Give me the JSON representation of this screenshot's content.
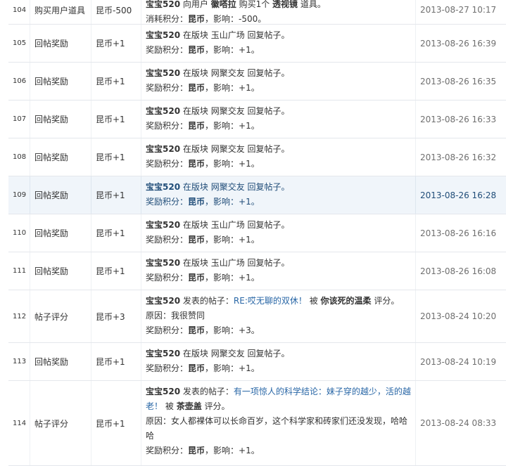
{
  "rows": [
    {
      "id": "104",
      "type": "购买用户道具",
      "amount": "昆币-500",
      "time": "2013-08-27 10:17",
      "line1": [
        "宝宝520",
        "向用户",
        "徽嗒拉",
        "购买1个",
        "透视镜",
        "道具。"
      ],
      "line2": [
        "消耗积分：",
        "昆币",
        "，影响：-500。"
      ]
    },
    {
      "id": "105",
      "type": "回帖奖励",
      "amount": "昆币+1",
      "time": "2013-08-26 16:39",
      "line1": [
        "宝宝520",
        "在版块 玉山广场 回复帖子。"
      ],
      "line2": [
        "奖励积分：",
        "昆币",
        "，影响：+1。"
      ]
    },
    {
      "id": "106",
      "type": "回帖奖励",
      "amount": "昆币+1",
      "time": "2013-08-26 16:35",
      "line1": [
        "宝宝520",
        "在版块 网聚交友 回复帖子。"
      ],
      "line2": [
        "奖励积分：",
        "昆币",
        "，影响：+1。"
      ]
    },
    {
      "id": "107",
      "type": "回帖奖励",
      "amount": "昆币+1",
      "time": "2013-08-26 16:33",
      "line1": [
        "宝宝520",
        "在版块 网聚交友 回复帖子。"
      ],
      "line2": [
        "奖励积分：",
        "昆币",
        "，影响：+1。"
      ]
    },
    {
      "id": "108",
      "type": "回帖奖励",
      "amount": "昆币+1",
      "time": "2013-08-26 16:32",
      "line1": [
        "宝宝520",
        "在版块 网聚交友 回复帖子。"
      ],
      "line2": [
        "奖励积分：",
        "昆币",
        "，影响：+1。"
      ]
    },
    {
      "id": "109",
      "type": "回帖奖励",
      "amount": "昆币+1",
      "time": "2013-08-26 16:28",
      "line1": [
        "宝宝520",
        "在版块 网聚交友 回复帖子。"
      ],
      "line2": [
        "奖励积分：",
        "昆币",
        "，影响：+1。"
      ]
    },
    {
      "id": "110",
      "type": "回帖奖励",
      "amount": "昆币+1",
      "time": "2013-08-26 16:16",
      "line1": [
        "宝宝520",
        "在版块 玉山广场 回复帖子。"
      ],
      "line2": [
        "奖励积分：",
        "昆币",
        "，影响：+1。"
      ]
    },
    {
      "id": "111",
      "type": "回帖奖励",
      "amount": "昆币+1",
      "time": "2013-08-26 16:08",
      "line1": [
        "宝宝520",
        "在版块 玉山广场 回复帖子。"
      ],
      "line2": [
        "奖励积分：",
        "昆币",
        "，影响：+1。"
      ]
    },
    {
      "id": "112",
      "type": "帖子评分",
      "amount": "昆币+3",
      "time": "2013-08-24 10:20",
      "line1": [
        "宝宝520",
        "发表的帖子：",
        "RE:哎无聊的双休！",
        "被",
        "你该死的温柔",
        "评分。"
      ],
      "reason": "原因：我很赞同",
      "line2": [
        "奖励积分：",
        "昆币",
        "，影响：+3。"
      ]
    },
    {
      "id": "113",
      "type": "回帖奖励",
      "amount": "昆币+1",
      "time": "2013-08-24 10:19",
      "line1": [
        "宝宝520",
        "在版块 网聚交友 回复帖子。"
      ],
      "line2": [
        "奖励积分：",
        "昆币",
        "，影响：+1。"
      ]
    },
    {
      "id": "114",
      "type": "帖子评分",
      "amount": "昆币+1",
      "time": "2013-08-24 08:33",
      "line1": [
        "宝宝520",
        "发表的帖子：",
        "有一项惊人的科学结论：妹子穿的越少，活的越老！",
        "被",
        "茶壶盖",
        "评分。"
      ],
      "reason": "原因：女人都裸体可以长命百岁，这个科学家和砖家们还没发现，哈哈哈",
      "line2": [
        "奖励积分：",
        "昆币",
        "，影响：+1。"
      ]
    }
  ]
}
